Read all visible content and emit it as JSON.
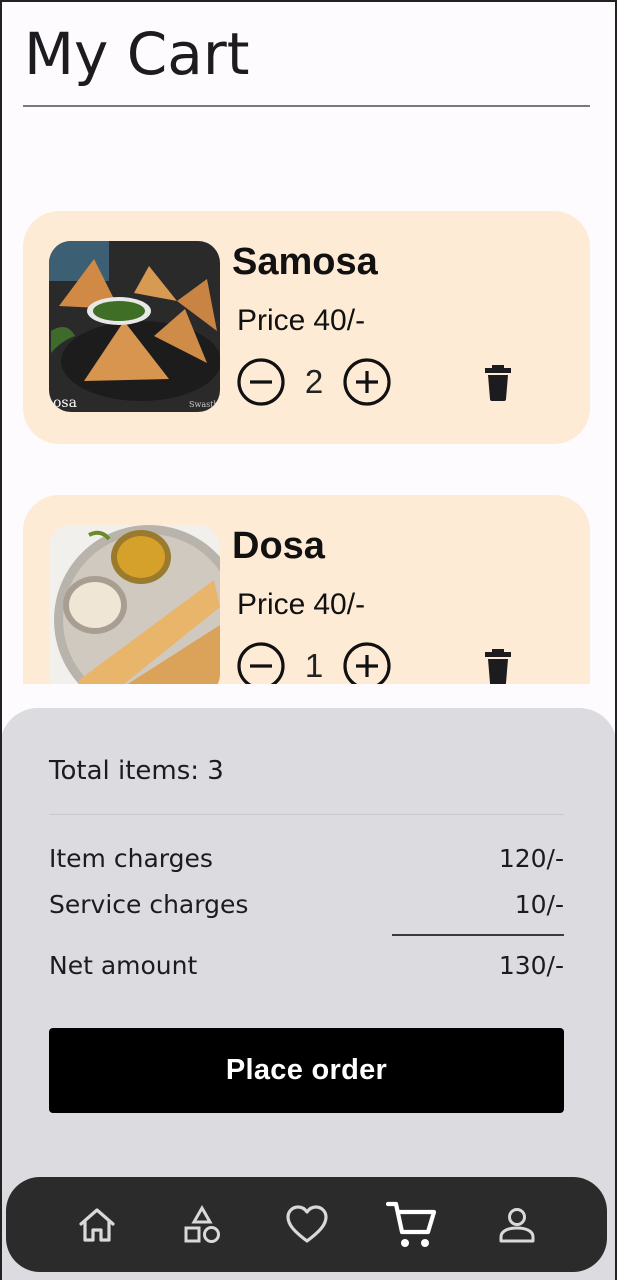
{
  "header": {
    "title": "My Cart"
  },
  "cart": {
    "items": [
      {
        "name": "Samosa",
        "price_label": "Price",
        "price": "40/-",
        "quantity": "2",
        "image": "samosa-image",
        "image_caption": "osa",
        "image_watermark": "Swasth"
      },
      {
        "name": "Dosa",
        "price_label": "Price",
        "price": "40/-",
        "quantity": "1",
        "image": "dosa-image"
      }
    ]
  },
  "summary": {
    "total_items_label": "Total items: 3",
    "item_charges_label": "Item charges",
    "item_charges_value": "120/-",
    "service_charges_label": "Service charges",
    "service_charges_value": "10/-",
    "net_amount_label": "Net amount",
    "net_amount_value": "130/-",
    "place_order_label": "Place order"
  },
  "nav": {
    "items": [
      {
        "icon": "home-icon",
        "active": false
      },
      {
        "icon": "categories-icon",
        "active": false
      },
      {
        "icon": "heart-icon",
        "active": false
      },
      {
        "icon": "cart-icon",
        "active": true
      },
      {
        "icon": "profile-icon",
        "active": false
      }
    ]
  },
  "colors": {
    "card_bg": "#fdebd6",
    "summary_bg": "#dcdbdf",
    "button_bg": "#000000",
    "navbar_bg": "#2b2b2b",
    "nav_icon": "#d9d9d9",
    "nav_icon_active": "#ffffff"
  }
}
